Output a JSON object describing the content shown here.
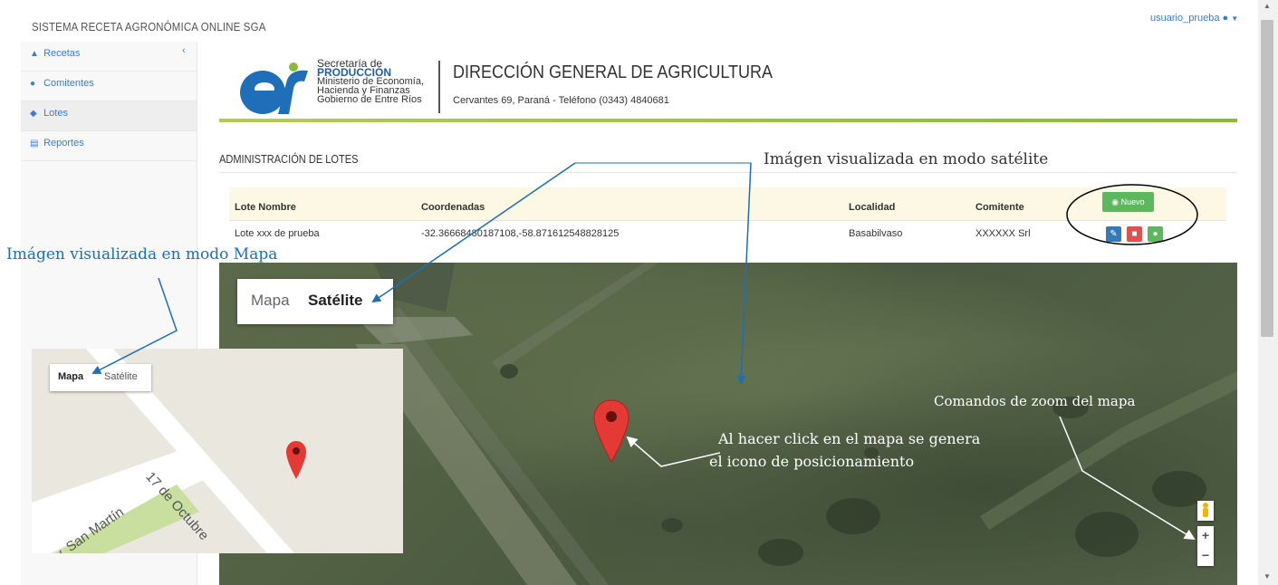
{
  "app": {
    "title": "SISTEMA RECETA AGRONÓMICA ONLINE SGA",
    "user": "usuario_prueba"
  },
  "sidebar": {
    "items": [
      {
        "label": "Recetas",
        "icon": "flask-icon"
      },
      {
        "label": "Comitentes",
        "icon": "users-icon"
      },
      {
        "label": "Lotes",
        "icon": "map-marker-icon",
        "active": true
      },
      {
        "label": "Reportes",
        "icon": "bar-chart-icon"
      }
    ]
  },
  "header": {
    "org_line1": "Secretaría de",
    "org_line2": "PRODUCCIÓN",
    "org_line3": "Ministerio de Economía,",
    "org_line4": "Hacienda y Finanzas",
    "org_line5": "Gobierno de Entre Ríos",
    "title": "DIRECCIÓN GENERAL DE AGRICULTURA",
    "subtitle": "Cervantes 69, Paraná - Teléfono (0343) 4840681"
  },
  "section": {
    "title": "ADMINISTRACIÓN DE LOTES"
  },
  "table": {
    "headers": [
      "Lote Nombre",
      "Coordenadas",
      "Localidad",
      "Comitente"
    ],
    "new_button": "Nuevo",
    "rows": [
      {
        "nombre": "Lote xxx de prueba",
        "coordenadas": "-32.36668480187108,-58.871612548828125",
        "localidad": "Basabilvaso",
        "comitente": "XXXXXX Srl"
      }
    ]
  },
  "map": {
    "type_map": "Mapa",
    "type_satellite": "Satélite",
    "zoom_in": "+",
    "zoom_out": "−"
  },
  "inset": {
    "type_map": "Mapa",
    "type_satellite": "Satélite",
    "street1": "17 de Octubre",
    "street2": "Av. San Martín"
  },
  "annotations": {
    "satellite": "Imágen visualizada en modo satélite",
    "map_mode": "Imágen visualizada en modo Mapa",
    "zoom": "Comandos de zoom del mapa",
    "click_line1": "Al hacer click en el mapa se genera",
    "click_line2": "el icono  de posicionamiento"
  },
  "colors": {
    "primary": "#3a7bd5",
    "success": "#5cb85c",
    "danger": "#d9534f",
    "marker": "#e53935",
    "header_accent": "#8bb83a"
  }
}
